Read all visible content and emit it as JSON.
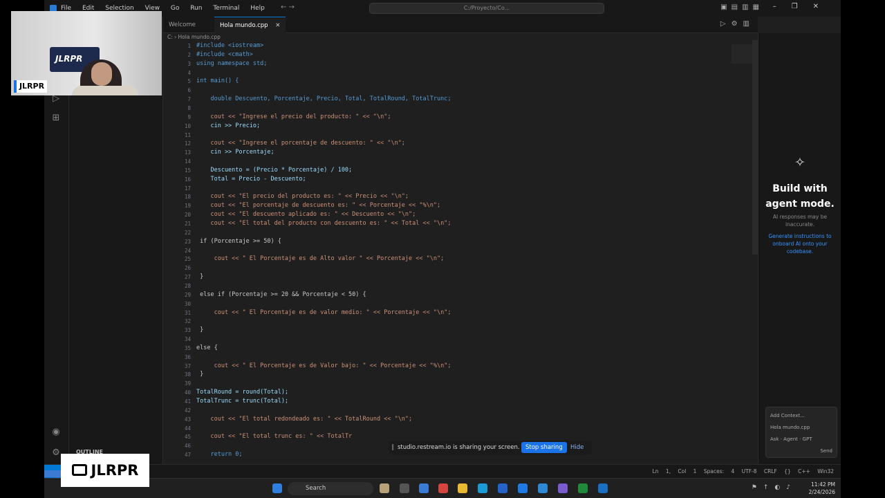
{
  "titlebar": {
    "menu": [
      "File",
      "Edit",
      "Selection",
      "View",
      "Go",
      "Run",
      "Terminal",
      "Help"
    ],
    "search": "C:/Proyecto/Co..."
  },
  "tabs": [
    {
      "label": "Welcome",
      "active": false
    },
    {
      "label": "Hola mundo.cpp",
      "active": true
    }
  ],
  "breadcrumb": "C: › Hola mundo.cpp",
  "editor": {
    "lines": [
      {
        "n": "1",
        "t": "#include <iostream>"
      },
      {
        "n": "2",
        "t": "#include <cmath>"
      },
      {
        "n": "3",
        "t": "using namespace std;"
      },
      {
        "n": "4",
        "t": ""
      },
      {
        "n": "5",
        "t": "int main() {"
      },
      {
        "n": "6",
        "t": ""
      },
      {
        "n": "7",
        "t": "    double Descuento, Porcentaje, Precio, Total, TotalRound, TotalTrunc;"
      },
      {
        "n": "8",
        "t": ""
      },
      {
        "n": "9",
        "t": "    cout << \"Ingrese el precio del producto: \" << \"\\n\";"
      },
      {
        "n": "10",
        "t": "    cin >> Precio;"
      },
      {
        "n": "11",
        "t": ""
      },
      {
        "n": "12",
        "t": "    cout << \"Ingrese el porcentaje de descuento: \" << \"\\n\";"
      },
      {
        "n": "13",
        "t": "    cin >> Porcentaje;"
      },
      {
        "n": "14",
        "t": ""
      },
      {
        "n": "15",
        "t": "    Descuento = (Precio * Porcentaje) / 100;"
      },
      {
        "n": "16",
        "t": "    Total = Precio - Descuento;"
      },
      {
        "n": "17",
        "t": ""
      },
      {
        "n": "18",
        "t": "    cout << \"El precio del producto es: \" << Precio << \"\\n\";"
      },
      {
        "n": "19",
        "t": "    cout << \"El porcentaje de descuento es: \" << Porcentaje << \"%\\n\";"
      },
      {
        "n": "20",
        "t": "    cout << \"El descuento aplicado es: \" << Descuento << \"\\n\";"
      },
      {
        "n": "21",
        "t": "    cout << \"El total del producto con descuento es: \" << Total << \"\\n\";"
      },
      {
        "n": "22",
        "t": ""
      },
      {
        "n": "23",
        "t": " if (Porcentaje >= 50) {"
      },
      {
        "n": "24",
        "t": ""
      },
      {
        "n": "25",
        "t": "     cout << \" El Porcentaje es de Alto valor \" << Porcentaje << \"\\n\";"
      },
      {
        "n": "26",
        "t": ""
      },
      {
        "n": "27",
        "t": " }"
      },
      {
        "n": "28",
        "t": ""
      },
      {
        "n": "29",
        "t": " else if (Porcentaje >= 20 && Porcentaje < 50) {"
      },
      {
        "n": "30",
        "t": ""
      },
      {
        "n": "31",
        "t": "     cout << \" El Porcentaje es de valor medio: \" << Porcentaje << \"\\n\";"
      },
      {
        "n": "32",
        "t": ""
      },
      {
        "n": "33",
        "t": " }"
      },
      {
        "n": "34",
        "t": ""
      },
      {
        "n": "35",
        "t": "else {"
      },
      {
        "n": "36",
        "t": ""
      },
      {
        "n": "37",
        "t": "     cout << \" El Porcentaje es de Valor bajo: \" << Porcentaje << \"%\\n\";"
      },
      {
        "n": "38",
        "t": " }"
      },
      {
        "n": "39",
        "t": ""
      },
      {
        "n": "40",
        "t": "TotalRound = round(Total);"
      },
      {
        "n": "41",
        "t": "TotalTrunc = trunc(Total);"
      },
      {
        "n": "42",
        "t": ""
      },
      {
        "n": "43",
        "t": "    cout << \"El total redondeado es: \" << TotalRound << \"\\n\";"
      },
      {
        "n": "44",
        "t": ""
      },
      {
        "n": "45",
        "t": "    cout << \"El total trunc es: \" << TotalTr"
      },
      {
        "n": "46",
        "t": ""
      },
      {
        "n": "47",
        "t": "    return 0;"
      }
    ]
  },
  "chat": {
    "title": "Build with agent mode.",
    "note": "AI responses may be inaccurate.",
    "link": "Generate instructions to onboard AI onto your codebase.",
    "popup": [
      "Add Context...",
      "Hola mundo.cpp",
      "Ask · Agent · GPT",
      "Send"
    ]
  },
  "explorer": {
    "outline": "OUTLINE"
  },
  "status": {
    "right": "Ln 1, Col 1   Spaces: 4   UTF-8   CRLF   {} C++   Win32"
  },
  "share": {
    "message": "studio.restream.io is sharing your screen.",
    "stop": "Stop sharing",
    "hide": "Hide"
  },
  "taskbar": {
    "search": "Search",
    "time": "11:42 PM",
    "date": "2/24/2026"
  },
  "overlay": {
    "cam_badge": "JLRPR",
    "poster": "JLRPR",
    "brand": "JLRPR"
  },
  "colors": {
    "accent": "#0078d4",
    "keyword": "#569cd6",
    "string": "#ce9178",
    "variable": "#9cdcfe"
  }
}
